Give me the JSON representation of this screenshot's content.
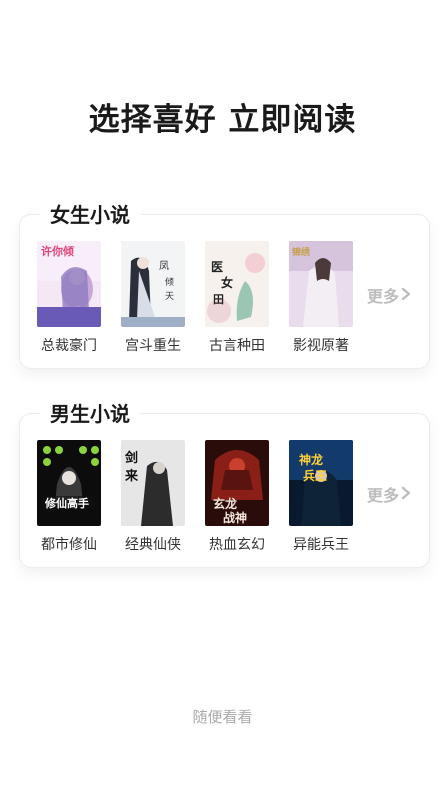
{
  "page": {
    "title": "选择喜好 立即阅读"
  },
  "female": {
    "heading": "女生小说",
    "more": "更多",
    "books": [
      {
        "label": "总裁豪门"
      },
      {
        "label": "宫斗重生"
      },
      {
        "label": "古言种田"
      },
      {
        "label": "影视原著"
      }
    ]
  },
  "male": {
    "heading": "男生小说",
    "more": "更多",
    "books": [
      {
        "label": "都市修仙"
      },
      {
        "label": "经典仙侠"
      },
      {
        "label": "热血玄幻"
      },
      {
        "label": "异能兵王"
      }
    ]
  },
  "footer": {
    "random": "随便看看"
  }
}
